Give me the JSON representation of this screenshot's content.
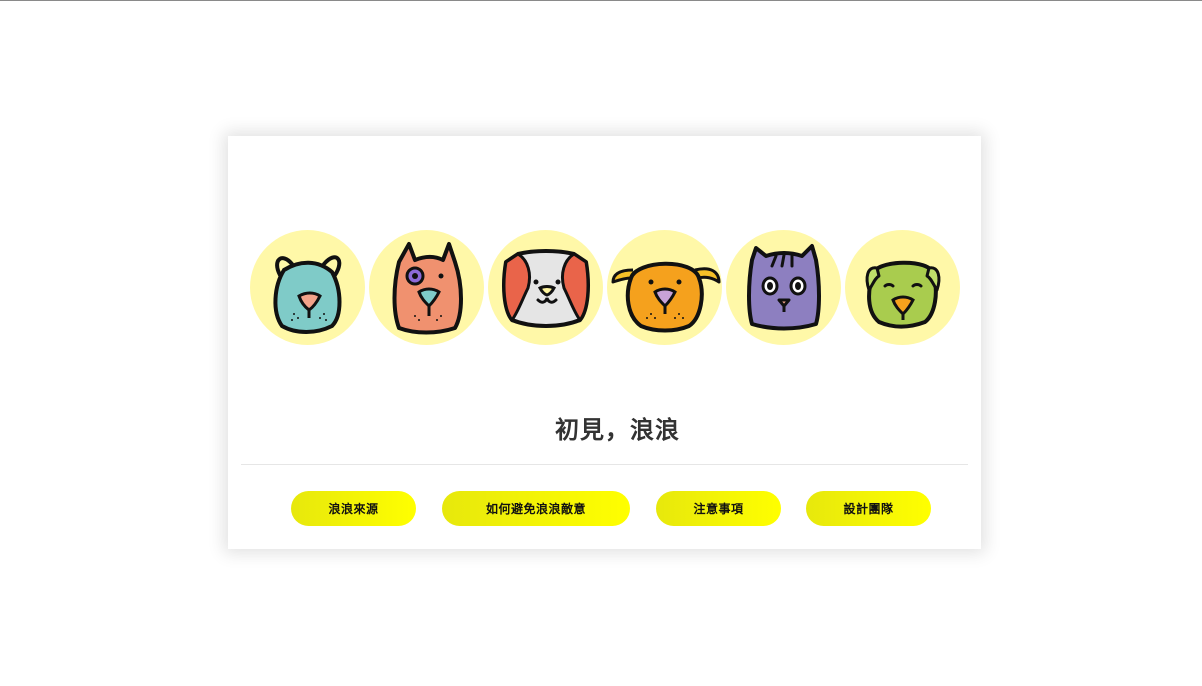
{
  "page": {
    "title": "初見，浪浪"
  },
  "animals": [
    {
      "name": "teal-dog",
      "color": "#7fcbc8",
      "nose": "#f2a38a"
    },
    {
      "name": "salmon-dog",
      "color": "#f0916f",
      "eye": "#8c6ad8",
      "nose": "#7fcbc8"
    },
    {
      "name": "calico-cat",
      "color": "#e5e5e5",
      "ears": "#e9644a",
      "nose": "#fff6a0"
    },
    {
      "name": "orange-dog",
      "color": "#f5a11d",
      "nose": "#c8a3d8"
    },
    {
      "name": "purple-cat",
      "color": "#8d7fc0",
      "nose": "#f2a38a"
    },
    {
      "name": "green-dog",
      "color": "#a9cc4e",
      "nose": "#f5a11d"
    }
  ],
  "nav": {
    "btn1": "浪浪來源",
    "btn2": "如何避免浪浪敵意",
    "btn3": "注意事項",
    "btn4": "設計團隊"
  },
  "colors": {
    "circle_bg": "#fff8a8",
    "button_start": "#e7e80c",
    "button_end": "#ffff00",
    "title": "#333333"
  }
}
